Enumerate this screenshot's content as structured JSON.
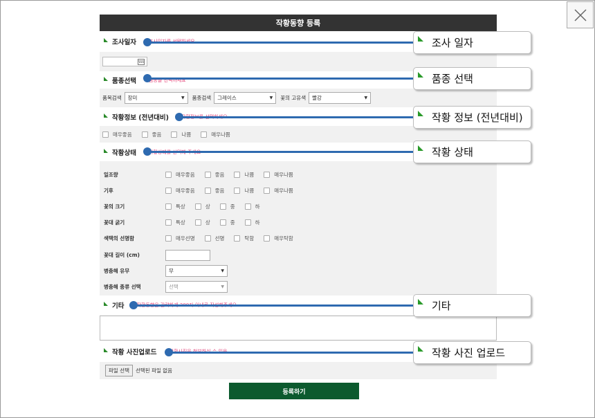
{
  "window": {
    "title": "작황동향 등록",
    "close_label": "close"
  },
  "sections": {
    "survey_date": {
      "title": "조사일자",
      "hint": "조사일자를 선택하세요",
      "calendar_icon": "calendar-icon"
    },
    "variety": {
      "title": "품종선택",
      "hint": "품종을 선택하세요",
      "item_label": "품목검색",
      "item_value": "장미",
      "variety_label": "품종검색",
      "variety_value": "그레이스",
      "color_label": "꽃의 고유색",
      "color_value": "빨강"
    },
    "growth_info": {
      "title": "작황정보 (전년대비)",
      "hint": "작황정보를 선택하세요",
      "options": [
        "매우좋음",
        "좋음",
        "나쁨",
        "매우나쁨"
      ]
    },
    "growth_status": {
      "title": "작황상태",
      "hint": "작황상태를 선택해 주세요",
      "rows": [
        {
          "label": "일조량",
          "options": [
            "매우좋음",
            "좋음",
            "나쁨",
            "매우나쁨"
          ]
        },
        {
          "label": "기후",
          "options": [
            "매우좋음",
            "좋음",
            "나쁨",
            "매우나쁨"
          ]
        },
        {
          "label": "꽃의 크기",
          "options": [
            "특상",
            "상",
            "중",
            "하"
          ]
        },
        {
          "label": "꽃대 굵기",
          "options": [
            "특상",
            "상",
            "중",
            "하"
          ]
        },
        {
          "label": "색택의 선명함",
          "options": [
            "매우선명",
            "선명",
            "탁함",
            "매우탁함"
          ]
        }
      ],
      "stem_length_label": "꽃대 길이 (cm)",
      "pest_label": "병충해 유무",
      "pest_value": "무",
      "pest_type_label": "병충해 종류 선택",
      "pest_type_value": "선택"
    },
    "etc": {
      "title": "기타",
      "hint": "작황동향을 간략하게 200자 이내로 작성해주세요"
    },
    "photo": {
      "title": "작황 사진업로드",
      "hint": "작황사진을 첨부하실 수 있음",
      "file_button": "파일 선택",
      "file_status": "선택된 파일 없음"
    }
  },
  "submit_label": "등록하기",
  "callouts": {
    "survey_date": "조사 일자",
    "variety": "품종 선택",
    "growth_info": "작황 정보 (전년대비)",
    "growth_status": "작황 상태",
    "etc": "기타",
    "photo": "작황 사진 업로드"
  },
  "colors": {
    "title_bar": "#333333",
    "accent_green": "#0c5a2e",
    "callout_blue": "#2e6ab0",
    "hint_pink": "#e0457a"
  }
}
